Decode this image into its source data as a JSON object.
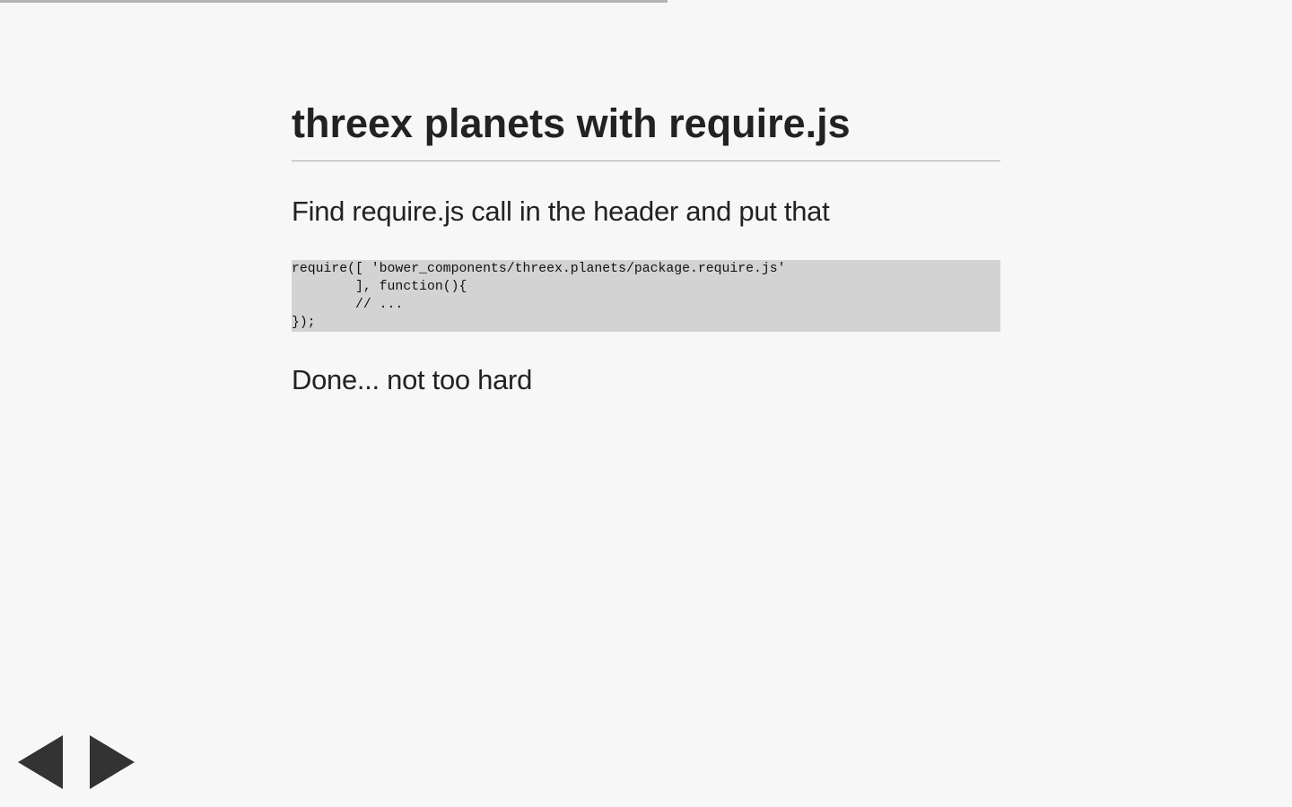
{
  "progress": {
    "fraction": 0.517
  },
  "slide": {
    "title": "threex planets with require.js",
    "paragraph_1": "Find require.js call in the header and put that",
    "code_lines": [
      "require([ 'bower_components/threex.planets/package.require.js'",
      "        ], function(){",
      "        // ...",
      "});"
    ],
    "paragraph_2": "Done... not too hard"
  },
  "navigation": {
    "prev_icon": "triangle-left-icon",
    "next_icon": "triangle-right-icon",
    "arrow_color": "#333333"
  },
  "colors": {
    "background": "#f7f7f7",
    "code_background": "#d3d3d3",
    "progress_bar": "#b5b5b5",
    "text": "#222222"
  }
}
